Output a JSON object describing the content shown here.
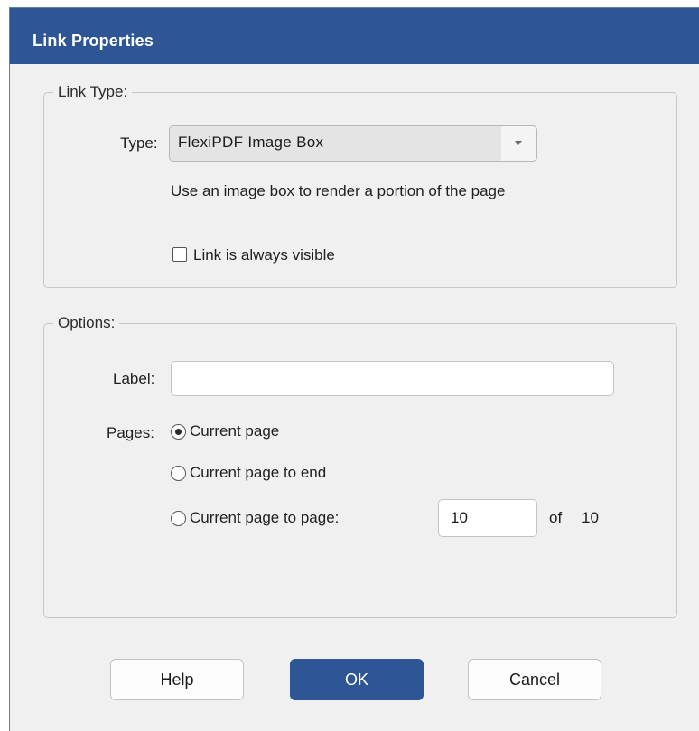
{
  "dialog": {
    "title": "Link Properties"
  },
  "link_type_group": {
    "legend": "Link Type:",
    "type_label": "Type:",
    "type_value": "FlexiPDF Image Box",
    "description": "Use an image box to render a portion of the page",
    "always_visible_label": "Link is always visible",
    "always_visible_checked": false
  },
  "options_group": {
    "legend": "Options:",
    "label_field_label": "Label:",
    "label_value": "",
    "pages_label": "Pages:",
    "radios": [
      {
        "label": "Current page",
        "selected": true
      },
      {
        "label": "Current page to end",
        "selected": false
      },
      {
        "label": "Current page to page:",
        "selected": false
      }
    ],
    "to_page_value": "10",
    "of_label": "of",
    "total_pages": "10"
  },
  "buttons": {
    "help": "Help",
    "ok": "OK",
    "cancel": "Cancel"
  },
  "colors": {
    "titlebar": "#2e5694",
    "primary_button": "#2e5694",
    "dialog_background": "#f0f0f0"
  }
}
